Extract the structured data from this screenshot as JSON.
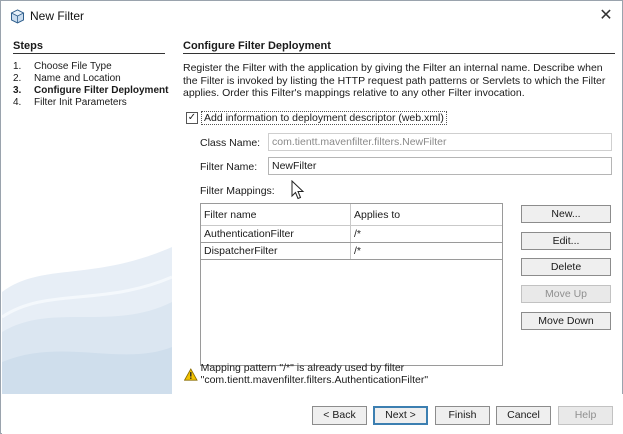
{
  "window": {
    "title": "New Filter"
  },
  "steps": {
    "title": "Steps",
    "items": [
      {
        "num": "1.",
        "label": "Choose File Type"
      },
      {
        "num": "2.",
        "label": "Name and Location"
      },
      {
        "num": "3.",
        "label": "Configure Filter Deployment",
        "current": true
      },
      {
        "num": "4.",
        "label": "Filter Init Parameters"
      }
    ]
  },
  "panel": {
    "title": "Configure Filter Deployment",
    "description": "Register the Filter with the application by giving the Filter an internal name. Describe when the Filter is invoked by listing the HTTP request path patterns or Servlets to which the Filter applies. Order this Filter's mappings relative to any other Filter invocation.",
    "checkbox": {
      "label": "Add information to deployment descriptor (web.xml)",
      "checked": true,
      "mark": "✓"
    },
    "class_name": {
      "label": "Class Name:",
      "value": "com.tientt.mavenfilter.filters.NewFilter"
    },
    "filter_name": {
      "label": "Filter Name:",
      "value": "NewFilter"
    },
    "mappings": {
      "label": "Filter Mappings:",
      "columns": [
        "Filter name",
        "Applies to"
      ],
      "rows": [
        [
          "AuthenticationFilter",
          "/*"
        ],
        [
          "DispatcherFilter",
          "/*"
        ]
      ]
    },
    "buttons": {
      "new": "New...",
      "edit": "Edit...",
      "delete": "Delete",
      "move_up": "Move Up",
      "move_down": "Move Down"
    },
    "warning": "Mapping pattern \"/*\" is already used by filter \"com.tientt.mavenfilter.filters.AuthenticationFilter\""
  },
  "footer": {
    "back": "< Back",
    "next": "Next >",
    "finish": "Finish",
    "cancel": "Cancel",
    "help": "Help"
  },
  "icons": {
    "app": "netbeans-cube-icon",
    "close": "close-icon",
    "warning": "warning-icon",
    "cursor": "mouse-pointer-icon"
  },
  "colors": {
    "accent": "#3c7fb1",
    "warning": "#f2c200"
  }
}
